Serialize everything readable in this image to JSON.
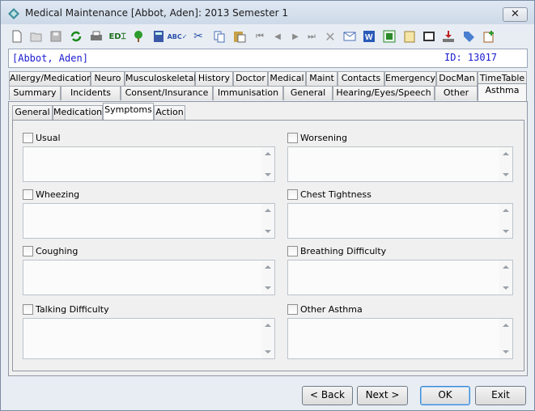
{
  "window": {
    "title": "Medical Maintenance   [Abbot, Aden]: 2013 Semester 1",
    "close_label": "✕"
  },
  "header": {
    "student": "[Abbot, Aden]",
    "id_text": "ID: 13017"
  },
  "tabs_row1": [
    "Allergy/Medication",
    "Neuro",
    "Musculoskeletal",
    "History",
    "Doctor",
    "Medical",
    "Maint",
    "Contacts",
    "Emergency",
    "DocMan",
    "TimeTable"
  ],
  "tabs_row2": [
    "Summary",
    "Incidents",
    "Consent/Insurance",
    "Immunisation",
    "General",
    "Hearing/Eyes/Speech",
    "Other",
    "Asthma"
  ],
  "subtabs": [
    "General",
    "Medication",
    "Symptoms",
    "Action"
  ],
  "symptoms": {
    "usual": "Usual",
    "worsening": "Worsening",
    "wheezing": "Wheezing",
    "chest_tightness": "Chest Tightness",
    "coughing": "Coughing",
    "breathing_difficulty": "Breathing Difficulty",
    "talking_difficulty": "Talking Difficulty",
    "other_asthma": "Other Asthma"
  },
  "buttons": {
    "back": "< Back",
    "next": "Next >",
    "ok": "OK",
    "exit": "Exit"
  },
  "toolbar_icons": [
    "new-icon",
    "open-icon",
    "save-icon",
    "refresh-icon",
    "print-icon",
    "edit-icon",
    "tree-icon",
    "calculator-icon",
    "spellcheck-icon",
    "cut-icon",
    "copy-icon",
    "paste-icon",
    "first-icon",
    "previous-icon",
    "next-icon",
    "last-icon",
    "delete-icon",
    "email-icon",
    "word-icon",
    "excel-icon",
    "notes-icon",
    "film-icon",
    "import-icon",
    "tag-icon",
    "task-icon"
  ]
}
